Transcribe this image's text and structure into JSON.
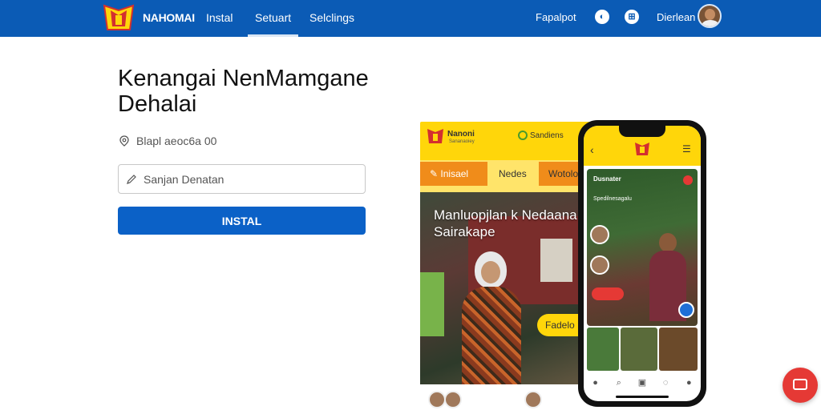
{
  "header": {
    "brand": "NAHOMAI",
    "nav": [
      "Instal",
      "Setuart",
      "Selclings"
    ],
    "active_nav": "Setuart",
    "right_link": "Fapalpot",
    "user_name": "Dierlean"
  },
  "main": {
    "title_line1": "Kenangai NenMamgane",
    "title_line2": "Dehalai",
    "location_text": "Blapl aeoc6a 00",
    "search_placeholder": "Sanjan Denatan",
    "install_button": "INSTAL"
  },
  "preview": {
    "brand": "Nanoni",
    "brand_sub": "Sananaoiey",
    "header_link": "Sandiens",
    "tabs": [
      "Inisael",
      "Nedes",
      "Wotolo"
    ],
    "hero_text": "Manluopjlan k Nedaana ter Sairakape",
    "hero_button": "Fadelo"
  },
  "phone": {
    "card_title": "Dusnater",
    "card_tag": "Spedilnesagalu",
    "colors": {
      "accent_yellow": "#ffd60a",
      "accent_orange": "#f08c1a",
      "primary_blue": "#0b5bb5",
      "danger_red": "#e53935"
    }
  }
}
